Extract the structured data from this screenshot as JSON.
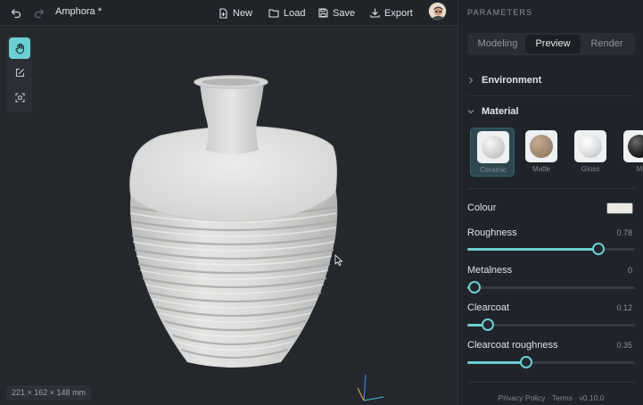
{
  "toolbar": {
    "title": "Amphora *",
    "new_label": "New",
    "load_label": "Load",
    "save_label": "Save",
    "export_label": "Export",
    "undo_icon": "undo-icon",
    "redo_icon": "redo-icon"
  },
  "viewport": {
    "tools": [
      "pan-hand-icon",
      "edit-icon",
      "frame-select-icon"
    ],
    "active_tool": "pan-hand-icon",
    "dimensions": "221 × 162 × 148 mm"
  },
  "panel": {
    "title": "PARAMETERS",
    "tabs": [
      {
        "label": "Modeling"
      },
      {
        "label": "Preview"
      },
      {
        "label": "Render"
      }
    ],
    "active_tab": "Preview",
    "sections": {
      "environment": "Environment",
      "material": "Material"
    },
    "materials": [
      {
        "name": "Ceramic",
        "color": "#d4d4d2"
      },
      {
        "name": "Matte",
        "color": "#a08670"
      },
      {
        "name": "Gloss",
        "color": "#d8d8d8"
      },
      {
        "name": "M",
        "color": "#202020"
      }
    ],
    "selected_material": "Ceramic",
    "colour": {
      "label": "Colour",
      "value": "#ece8e2"
    },
    "sliders": [
      {
        "label": "Roughness",
        "value": "0.78",
        "fraction": 0.78
      },
      {
        "label": "Metalness",
        "value": "0",
        "fraction": 0
      },
      {
        "label": "Clearcoat",
        "value": "0.12",
        "fraction": 0.12
      },
      {
        "label": "Clearcoat roughness",
        "value": "0.35",
        "fraction": 0.35
      }
    ],
    "footer": "Privacy Policy  ·  Terms  ·  v0.10.0"
  },
  "colors": {
    "accent": "#6ccfd3",
    "background": "#24272c",
    "panel": "#202329"
  }
}
